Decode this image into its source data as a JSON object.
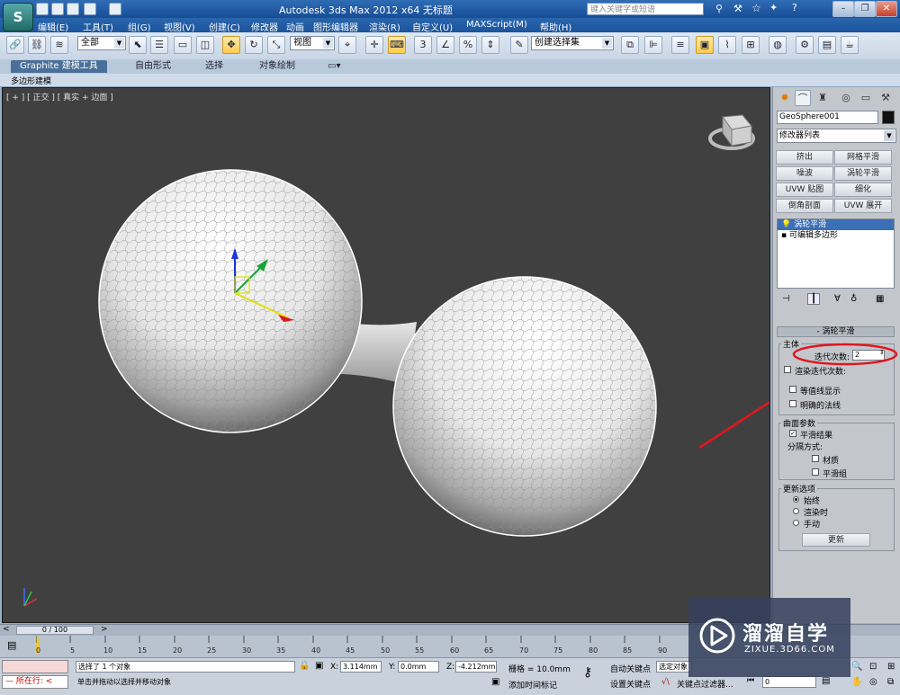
{
  "app": {
    "logo_text": "S",
    "title": "Autodesk 3ds Max  2012 x64     无标题",
    "search_placeholder": "键入关键字或短语"
  },
  "menu": [
    "编辑(E)",
    "工具(T)",
    "组(G)",
    "视图(V)",
    "创建(C)",
    "修改器",
    "动画",
    "图形编辑器",
    "渲染(R)",
    "自定义(U)",
    "MAXScript(M)",
    "帮助(H)"
  ],
  "toolbar": {
    "selection_filter": "全部",
    "reference_coord": "视图",
    "named_selection": "创建选择集",
    "snap_3": "3",
    "snap_percent": "%"
  },
  "ribbon": {
    "tabs": [
      "Graphite 建模工具",
      "自由形式",
      "选择",
      "对象绘制"
    ],
    "sub_label": "多边形建模"
  },
  "viewport": {
    "label": "[ + ] [ 正交 ] [ 真实 + 边面 ]",
    "axis_z": "z"
  },
  "command_panel": {
    "object_name": "GeoSphere001",
    "modifier_list": "修改器列表",
    "modifier_buttons": [
      "挤出",
      "网格平滑",
      "噪波",
      "涡轮平滑",
      "UVW 贴图",
      "细化",
      "倒角剖面",
      "UVW 展开"
    ],
    "stack": [
      "涡轮平滑",
      "可编辑多边形"
    ],
    "rollout_title": "涡轮平滑",
    "main_group": "主体",
    "iterations_label": "迭代次数:",
    "iterations_value": "2",
    "render_iters_label": "渲染迭代次数:",
    "isoline_display": "等值线显示",
    "explicit_normals": "明确的法线",
    "surface_group": "曲面参数",
    "smooth_result": "平滑结果",
    "separate_by": "分隔方式:",
    "materials": "材质",
    "smoothing_groups": "平滑组",
    "update_group": "更新选项",
    "always": "始终",
    "when_rendering": "渲染时",
    "manually": "手动",
    "update_button": "更新"
  },
  "timeline": {
    "frame_display": "0 / 100",
    "ticks": [
      "0",
      "5",
      "10",
      "15",
      "20",
      "25",
      "30",
      "35",
      "40",
      "45",
      "50",
      "55",
      "60",
      "65",
      "70",
      "75",
      "80",
      "85",
      "90"
    ]
  },
  "status": {
    "mode_label": "所在行:",
    "selected": "选择了 1 个对象",
    "prompt": "单击并拖动以选择并移动对象",
    "x_label": "X:",
    "x_value": "3.114mm",
    "y_label": "Y:",
    "y_value": "0.0mm",
    "z_label": "Z:",
    "z_value": "-4.212mm",
    "grid": "栅格 = 10.0mm",
    "add_time_tag": "添加时间标记",
    "auto_key": "自动关键点",
    "set_key": "设置关键点",
    "selected_object": "选定对象",
    "key_filters": "关键点过滤器...",
    "frame_field": "0"
  },
  "watermark": {
    "brand": "溜溜自学",
    "url": "ZIXUE.3D66.COM"
  },
  "colors": {
    "annotation_red": "#e0161c",
    "viewport_bg": "#404040",
    "selection_blue": "#3b6fb6"
  }
}
